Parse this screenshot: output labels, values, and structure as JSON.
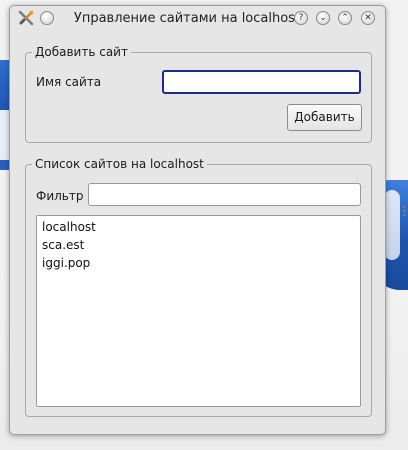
{
  "window": {
    "title": "Управление сайтами на localhost",
    "buttons": {
      "help": "?",
      "minimize": "⌄",
      "maximize": "⌃",
      "close": "✕"
    }
  },
  "add_site": {
    "group_title": "Добавить сайт",
    "name_label": "Имя сайта",
    "name_value": "",
    "add_button": "Добавить"
  },
  "site_list": {
    "group_title": "Список сайтов на localhost",
    "filter_label": "Фильтр",
    "filter_value": "",
    "items": [
      {
        "label": "localhost"
      },
      {
        "label": "sca.est"
      },
      {
        "label": "iggi.pop"
      }
    ]
  },
  "icons": {
    "app": "tools-icon",
    "help": "help-icon",
    "minimize": "minimize-icon",
    "maximize": "maximize-icon",
    "close": "close-icon"
  },
  "colors": {
    "focus_border": "#1d2b8a",
    "window_bg": "#e6e6e6",
    "desktop_accent": "#2f6fd0"
  }
}
